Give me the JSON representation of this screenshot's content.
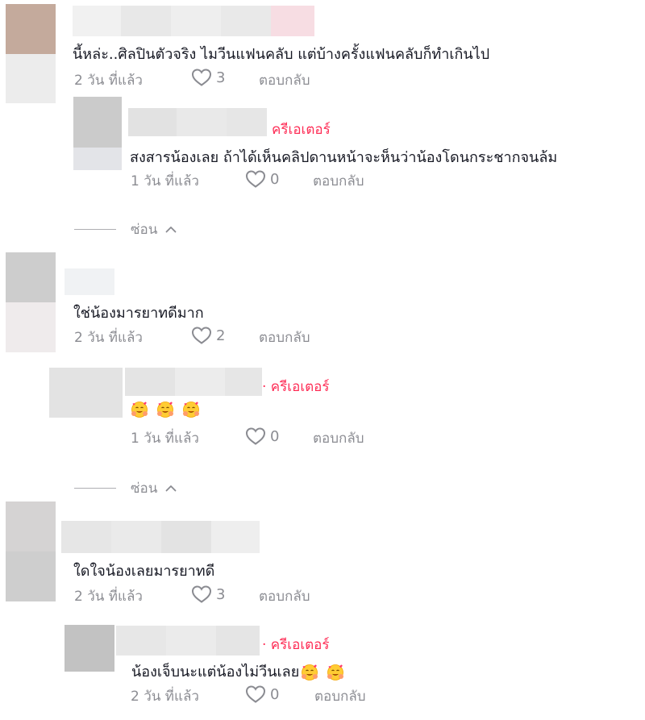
{
  "comments": [
    {
      "text": "นี้หล่ะ..ศิลปินตัวจริง ไมวีนแฟนคลับ แต่บ้างครั้งแฟนคลับก็ทำเกินไป",
      "time": "2 วัน ที่แล้ว",
      "likes": "3",
      "reply_label": "ตอบกลับ",
      "replies": [
        {
          "badge": "ครีเอเตอร์",
          "text": "สงสารน้องเลย ถ้าได้เห็นคลิปดานหน้าจะห็นว่าน้องโดนกระชากจนล้ม",
          "time": "1 วัน ที่แล้ว",
          "likes": "0",
          "reply_label": "ตอบกลับ"
        }
      ],
      "hide_label": "ซ่อน"
    },
    {
      "text": "ใช่น้องมารยาทดีมาก",
      "time": "2 วัน ที่แล้ว",
      "likes": "2",
      "reply_label": "ตอบกลับ",
      "replies": [
        {
          "badge": "· ครีเอเตอร์",
          "text": "",
          "emojis": [
            "hugging-face",
            "hugging-face",
            "hugging-face"
          ],
          "time": "1 วัน ที่แล้ว",
          "likes": "0",
          "reply_label": "ตอบกลับ"
        }
      ],
      "hide_label": "ซ่อน"
    },
    {
      "text": "ใดใจน้องเลยมารยาทดี",
      "time": "2 วัน ที่แล้ว",
      "likes": "3",
      "reply_label": "ตอบกลับ",
      "replies": [
        {
          "badge": "· ครีเอเตอร์",
          "text": "น้องเจ็บนะแต่น้องไม่วีนเลย",
          "emojis": [
            "hugging-face",
            "hugging-face"
          ],
          "time": "2 วัน ที่แล้ว",
          "likes": "0",
          "reply_label": "ตอบกลับ"
        }
      ]
    }
  ],
  "colors": {
    "creator_badge": "#fe2c55",
    "secondary_text": "#8a8b91",
    "primary_text": "#161823"
  },
  "icons": {
    "like": "heart-outline-icon",
    "collapse": "chevron-up-icon"
  }
}
